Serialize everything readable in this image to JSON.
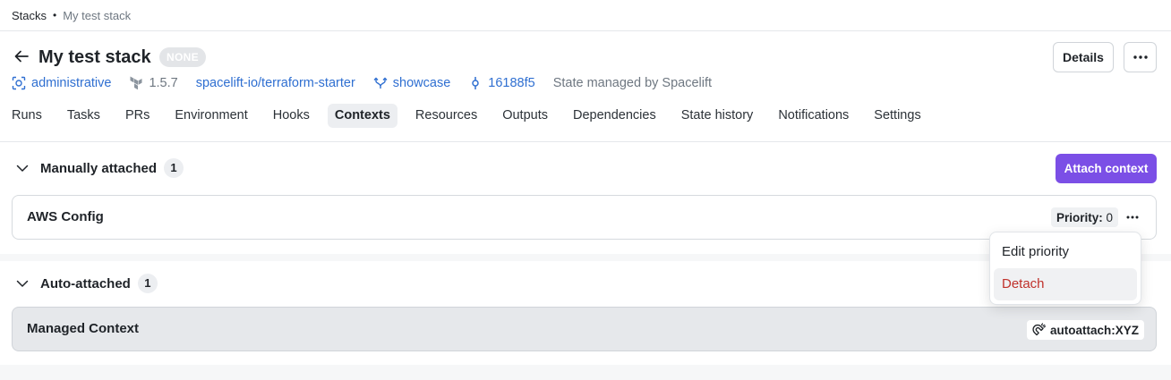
{
  "breadcrumb": {
    "root": "Stacks",
    "separator": "•",
    "current": "My test stack"
  },
  "header": {
    "back_icon": "arrow-left-icon",
    "title": "My test stack",
    "state_badge": "NONE",
    "details_label": "Details",
    "more_icon": "ellipsis-icon"
  },
  "meta": {
    "space": "administrative",
    "version": "1.5.7",
    "repository": "spacelift-io/terraform-starter",
    "branch": "showcase",
    "commit": "16188f5",
    "state_note": "State managed by Spacelift"
  },
  "tabs": [
    "Runs",
    "Tasks",
    "PRs",
    "Environment",
    "Hooks",
    "Contexts",
    "Resources",
    "Outputs",
    "Dependencies",
    "State history",
    "Notifications",
    "Settings"
  ],
  "active_tab": "Contexts",
  "manual": {
    "title": "Manually attached",
    "count": "1",
    "attach_label": "Attach context",
    "contexts": [
      {
        "name": "AWS Config",
        "priority_label": "Priority:",
        "priority_value": "0"
      }
    ]
  },
  "auto": {
    "title": "Auto-attached",
    "count": "1",
    "contexts": [
      {
        "name": "Managed Context",
        "label": "autoattach:XYZ"
      }
    ]
  },
  "menu": {
    "items": [
      "Edit priority",
      "Detach"
    ]
  },
  "colors": {
    "accent": "#7b4fe6",
    "link": "#2f6fd1",
    "danger": "#c0312b"
  }
}
